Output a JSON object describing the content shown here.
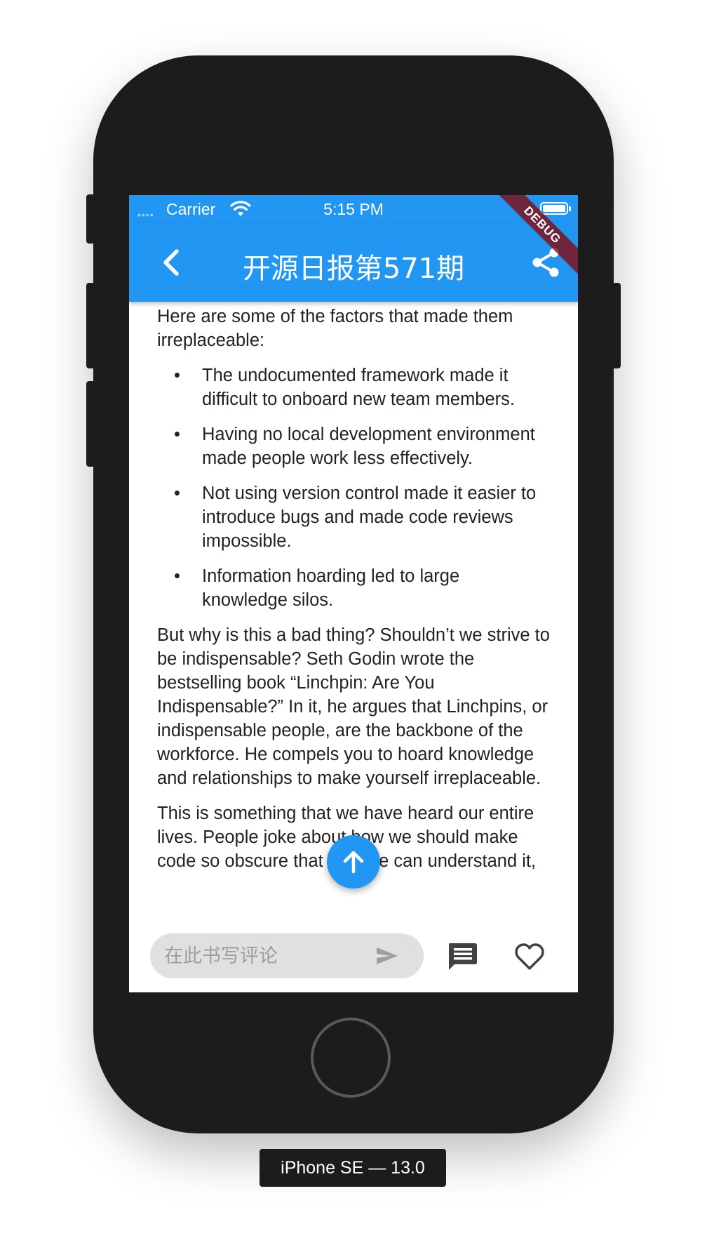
{
  "status_bar": {
    "carrier": "Carrier",
    "time": "5:15 PM"
  },
  "app_bar": {
    "title": "开源日报第571期",
    "debug_label": "DEBUG"
  },
  "article": {
    "intro": " Here are some of the factors that made them irreplaceable:",
    "bullet_symbol": "•",
    "bullets": [
      "  The undocumented framework made it difficult to onboard new team members.",
      "  Having no local development environment made people work less effectively.",
      "  Not using version control made it easier to introduce bugs and made code reviews impossible.",
      "  Information hoarding led to large knowledge silos."
    ],
    "paragraph_2": " But why is this a bad thing? Shouldn’t we strive to be indispensable? Seth Godin wrote the bestselling book “Linchpin: Are You Indispensable?” In it, he argues that Linchpins, or indispensable people, are the backbone of the workforce. He compels you to hoard knowledge and relationships to make yourself irreplaceable.",
    "paragraph_3": " This is something that we have heard our entire lives. People joke about how we should make code so obscure that only we can understand it,"
  },
  "bottom_bar": {
    "comment_placeholder": "在此书写评论"
  },
  "device": {
    "label": "iPhone SE — 13.0"
  },
  "colors": {
    "primary": "#2196f3",
    "device_body": "#1c1c1c",
    "debug_ribbon": "#880000"
  },
  "icons": {
    "back": "arrow-back-ios-icon",
    "share": "share-icon",
    "scroll_top": "arrow-upward-icon",
    "send": "send-icon",
    "comments": "comment-icon",
    "like": "heart-outline-icon",
    "wifi": "wifi-icon",
    "battery": "battery-icon"
  }
}
